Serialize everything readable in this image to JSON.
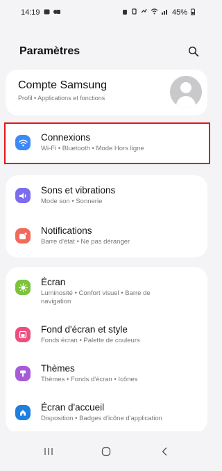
{
  "status": {
    "time": "14:19",
    "battery": "45%",
    "left_icons": [
      "notification-icon",
      "app-icon"
    ],
    "right_icons": [
      "alarm-icon",
      "vibrate-icon",
      "mute-icon",
      "wifi-icon",
      "signal-icon",
      "battery-icon"
    ]
  },
  "header": {
    "title": "Paramètres",
    "search_icon": "search-icon"
  },
  "account": {
    "title": "Compte Samsung",
    "subtitle": "Profil • Applications et fonctions",
    "avatar_icon": "person-icon"
  },
  "items": [
    {
      "title": "Connexions",
      "subtitle": "Wi-Fi • Bluetooth • Mode Hors ligne",
      "icon": "wifi-icon",
      "color": "#3d8af7"
    },
    {
      "title": "Sons et vibrations",
      "subtitle": "Mode son • Sonnerie",
      "icon": "volume-icon",
      "color": "#7b6cf0"
    },
    {
      "title": "Notifications",
      "subtitle": "Barre d'état • Ne pas déranger",
      "icon": "notification-icon",
      "color": "#f26a5a"
    },
    {
      "title": "Écran",
      "subtitle": "Luminosité • Confort visuel • Barre de",
      "subtitle2": "navigation",
      "icon": "brightness-icon",
      "color": "#7cc33a"
    },
    {
      "title": "Fond d'écran et style",
      "subtitle": "Fonds écran • Palette de couleurs",
      "icon": "wallpaper-icon",
      "color": "#ee4d80"
    },
    {
      "title": "Thèmes",
      "subtitle": "Thèmes • Fonds d'écran • Icônes",
      "icon": "themes-icon",
      "color": "#a65cd8"
    },
    {
      "title": "Écran d'accueil",
      "subtitle": "Disposition • Badges d'icône d'application",
      "icon": "home-icon",
      "color": "#1d7fe0"
    }
  ],
  "highlight_color": "#e0161e",
  "nav": {
    "recent_icon": "recent-apps-icon",
    "home_icon": "home-button-icon",
    "back_icon": "back-icon"
  }
}
